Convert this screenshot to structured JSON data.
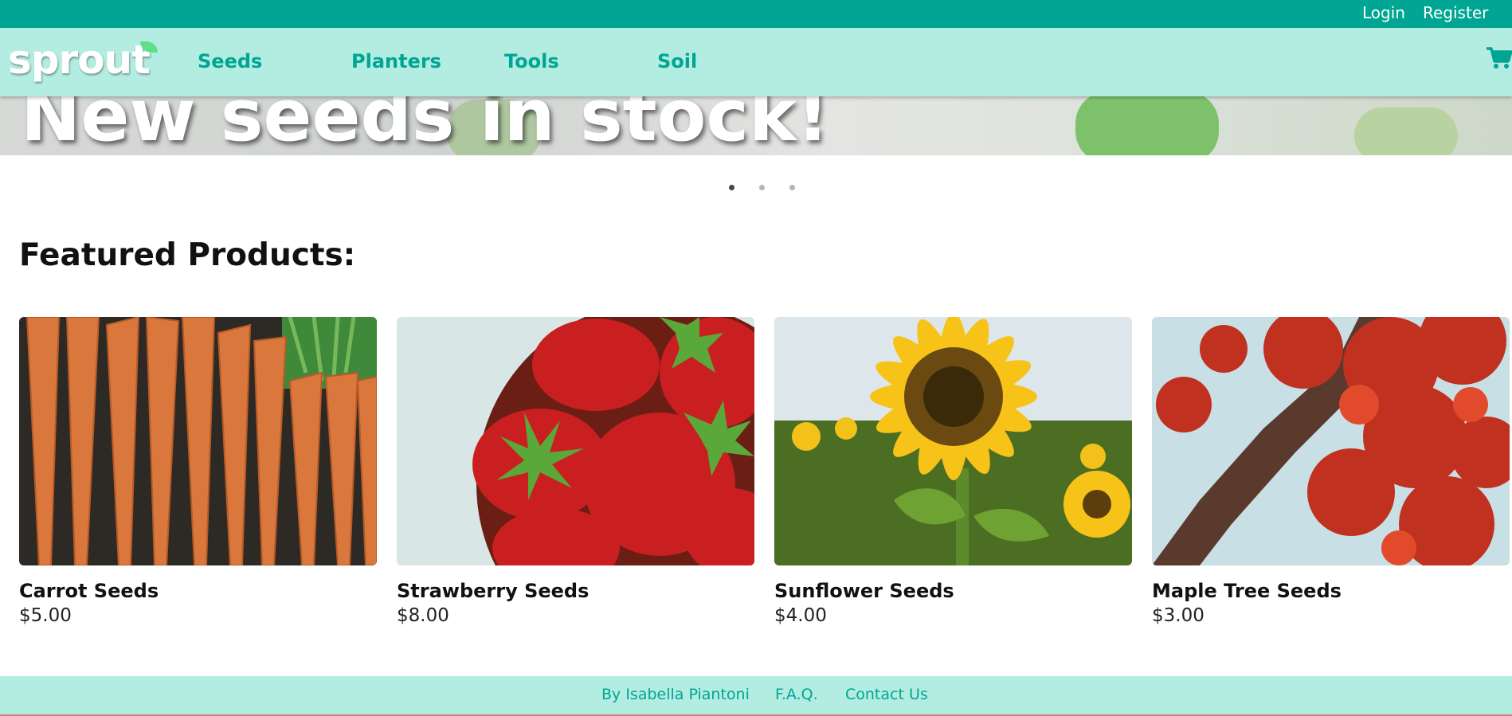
{
  "topbar": {
    "login": "Login",
    "register": "Register"
  },
  "brand": {
    "logo": "sprout"
  },
  "nav": {
    "seeds": "Seeds",
    "planters": "Planters",
    "tools": "Tools",
    "soil": "Soil"
  },
  "icons": {
    "cart": "shopping-cart-icon"
  },
  "hero": {
    "title": "New seeds in stock!",
    "active_slide": 1,
    "slide_count": 3
  },
  "featured": {
    "heading": "Featured Products:",
    "products": [
      {
        "name": "Carrot Seeds",
        "price": "$5.00"
      },
      {
        "name": "Strawberry Seeds",
        "price": "$8.00"
      },
      {
        "name": "Sunflower Seeds",
        "price": "$4.00"
      },
      {
        "name": "Maple Tree Seeds",
        "price": "$3.00"
      }
    ]
  },
  "footer": {
    "author": "By Isabella Piantoni",
    "faq": "F.A.Q.",
    "contact": "Contact Us"
  },
  "colors": {
    "accent": "#00a693",
    "nav_bg": "#b3ece0",
    "text": "#111111"
  }
}
